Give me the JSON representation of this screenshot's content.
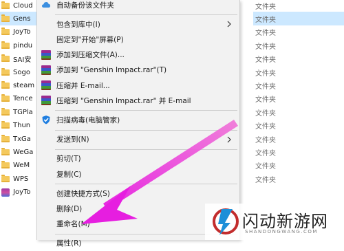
{
  "explorer": {
    "files": [
      {
        "name": "Cloud",
        "icon": "folder-icon",
        "type": "文件夹"
      },
      {
        "name": "Gens",
        "icon": "folder-icon",
        "type": "文件夹",
        "selected": true
      },
      {
        "name": "JoyTo",
        "icon": "folder-icon",
        "type": "文件夹"
      },
      {
        "name": "pindu",
        "icon": "folder-icon",
        "type": "文件夹"
      },
      {
        "name": "SAI安",
        "icon": "folder-icon",
        "type": "文件夹"
      },
      {
        "name": "Sogo",
        "icon": "folder-icon",
        "type": "文件夹"
      },
      {
        "name": "steam",
        "icon": "folder-icon",
        "type": "文件夹"
      },
      {
        "name": "Tence",
        "icon": "folder-icon",
        "type": "文件夹"
      },
      {
        "name": "TGPla",
        "icon": "folder-icon",
        "type": "文件夹"
      },
      {
        "name": "Thun",
        "icon": "folder-icon",
        "type": "文件夹"
      },
      {
        "name": "TxGa",
        "icon": "folder-icon",
        "type": "文件夹"
      },
      {
        "name": "WeGa",
        "icon": "folder-icon",
        "type": "文件夹"
      },
      {
        "name": "WeM",
        "icon": "folder-icon",
        "type": "文件夹"
      },
      {
        "name": "WPS",
        "icon": "folder-icon",
        "type": "文件夹"
      },
      {
        "name": "JoyTo",
        "icon": "app-icon",
        "type": ""
      }
    ]
  },
  "context_menu": {
    "items": [
      {
        "label": "自动备份该文件夹",
        "icon": "cloud-icon"
      },
      {
        "separator": true
      },
      {
        "label": "包含到库中(I)",
        "submenu": true
      },
      {
        "label": "固定到\"开始\"屏幕(P)"
      },
      {
        "label": "添加到压缩文件(A)...",
        "icon": "winrar-icon"
      },
      {
        "label": "添加到 \"Genshin Impact.rar\"(T)",
        "icon": "winrar-icon"
      },
      {
        "label": "压缩并 E-mail...",
        "icon": "winrar-icon"
      },
      {
        "label": "压缩到 \"Genshin Impact.rar\" 并 E-mail",
        "icon": "winrar-icon"
      },
      {
        "separator": true
      },
      {
        "label": "扫描病毒(电脑管家)",
        "icon": "shield-icon"
      },
      {
        "separator": true
      },
      {
        "label": "发送到(N)",
        "submenu": true
      },
      {
        "separator": true
      },
      {
        "label": "剪切(T)"
      },
      {
        "label": "复制(C)"
      },
      {
        "separator": true
      },
      {
        "label": "创建快捷方式(S)"
      },
      {
        "label": "删除(D)"
      },
      {
        "label": "重命名(M)"
      },
      {
        "separator": true
      },
      {
        "label": "属性(R)"
      }
    ]
  },
  "watermark": {
    "title": "闪动新游网",
    "subtitle": "SHANDONGWANG.COM"
  },
  "colors": {
    "arrow": "#e61ee0",
    "selection": "#cce8ff",
    "menu_bg": "#f2f2f2"
  }
}
